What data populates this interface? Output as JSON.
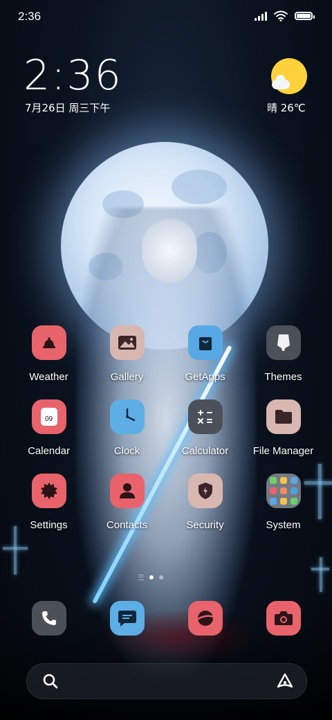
{
  "status_bar": {
    "time": "2:36",
    "battery_level": 1.0,
    "icons": [
      "signal-icon",
      "wifi-icon",
      "battery-icon"
    ]
  },
  "clock_widget": {
    "time": "2:36",
    "date": "7月26日 周三下午"
  },
  "weather_widget": {
    "icon": "sun-cloud-icon",
    "text": "晴 26℃"
  },
  "apps": [
    {
      "label": "Weather",
      "icon": "weather-icon",
      "color": "#e8636b"
    },
    {
      "label": "Gallery",
      "icon": "gallery-icon",
      "color": "#d9b7b1"
    },
    {
      "label": "GetApps",
      "icon": "shopping-bag-icon",
      "color": "#58a8e6"
    },
    {
      "label": "Themes",
      "icon": "brush-icon",
      "color": "#4b5059"
    },
    {
      "label": "Calendar",
      "icon": "calendar-icon",
      "color": "#e8636b",
      "badge": "09"
    },
    {
      "label": "Clock",
      "icon": "clock-icon",
      "color": "#5eaee6"
    },
    {
      "label": "Calculator",
      "icon": "calculator-icon",
      "color": "#4b5059"
    },
    {
      "label": "File Manager",
      "icon": "folder-icon",
      "color": "#d9b7b1"
    },
    {
      "label": "Settings",
      "icon": "gear-icon",
      "color": "#e8636b"
    },
    {
      "label": "Contacts",
      "icon": "person-icon",
      "color": "#e8636b"
    },
    {
      "label": "Security",
      "icon": "shield-icon",
      "color": "#d9b7b1"
    },
    {
      "label": "System",
      "icon": "folder-group-icon",
      "color": "#c8cfd8"
    }
  ],
  "system_folder_colors": [
    "#6fcf6a",
    "#f2c14e",
    "#5aa7e6",
    "#e8636b",
    "#f08a5d",
    "#4aa3df",
    "#5aa7e6",
    "#f2c14e",
    "#6fcf6a"
  ],
  "page_indicator": {
    "pages": 2,
    "active": 1
  },
  "dock": [
    {
      "icon": "phone-icon",
      "color": "#4b5059"
    },
    {
      "icon": "message-icon",
      "color": "#5eaee6"
    },
    {
      "icon": "browser-icon",
      "color": "#e8636b"
    },
    {
      "icon": "camera-icon",
      "color": "#e8636b"
    }
  ],
  "search_bar": {
    "left_icon": "search-icon",
    "right_icon": "assistant-icon"
  }
}
